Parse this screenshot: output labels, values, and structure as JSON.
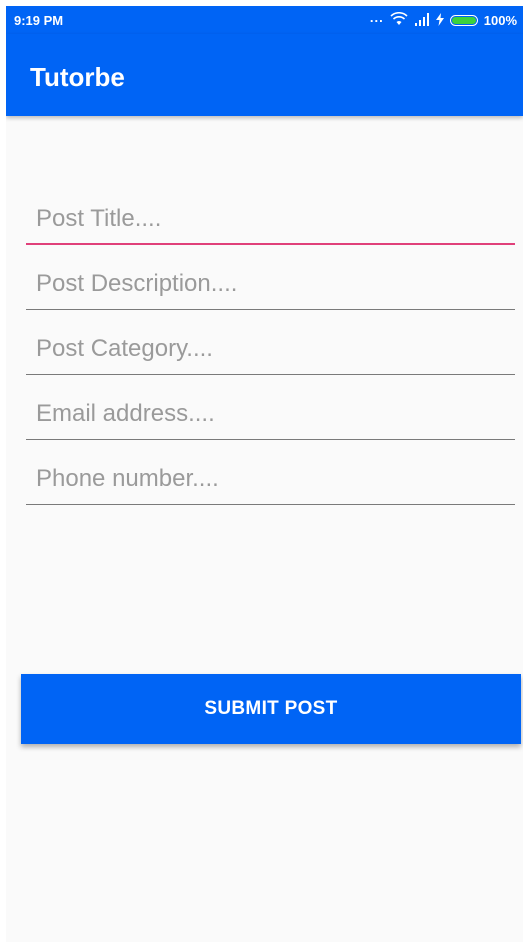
{
  "status_bar": {
    "time": "9:19 PM",
    "dots": "...",
    "battery_percent": "100%",
    "icons": [
      "wifi-icon",
      "signal-icon",
      "charging-icon",
      "battery-icon"
    ]
  },
  "app_bar": {
    "title": "Tutorbe"
  },
  "form": {
    "fields": [
      {
        "name": "post-title",
        "placeholder": "Post Title....",
        "value": "",
        "focused": true
      },
      {
        "name": "post-description",
        "placeholder": "Post Description....",
        "value": "",
        "focused": false
      },
      {
        "name": "post-category",
        "placeholder": "Post Category....",
        "value": "",
        "focused": false
      },
      {
        "name": "email-address",
        "placeholder": "Email address....",
        "value": "",
        "focused": false
      },
      {
        "name": "phone-number",
        "placeholder": "Phone number....",
        "value": "",
        "focused": false
      }
    ],
    "submit_label": "SUBMIT POST"
  },
  "colors": {
    "primary": "#0064f5",
    "accent": "#e0407a",
    "background": "#fafafa",
    "battery": "#3cd23c"
  }
}
